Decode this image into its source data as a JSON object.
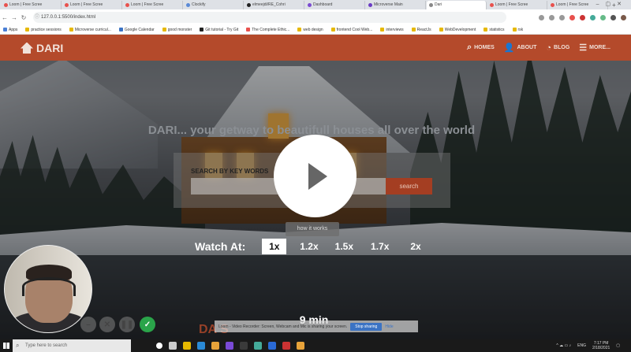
{
  "browser": {
    "tabs": [
      {
        "title": "Loom | Free Scree",
        "icon_color": "#e8514d"
      },
      {
        "title": "Loom | Free Scree",
        "icon_color": "#e8514d"
      },
      {
        "title": "Loom | Free Scree",
        "icon_color": "#e8514d"
      },
      {
        "title": "Clockify",
        "icon_color": "#5b8ad6"
      },
      {
        "title": "elmeejdi/RE_Cohri",
        "icon_color": "#222222"
      },
      {
        "title": "Dashboard",
        "icon_color": "#7b4bd1"
      },
      {
        "title": "Microverse Main",
        "icon_color": "#6b3cc4"
      },
      {
        "title": "Dari",
        "icon_color": "#888888",
        "active": true
      },
      {
        "title": "Loom | Free Scree",
        "icon_color": "#e8514d"
      },
      {
        "title": "Loom | Free Scree",
        "icon_color": "#e8514d"
      }
    ],
    "new_tab": "+",
    "url": "127.0.0.1:5500/index.html",
    "bookmarks": [
      {
        "label": "Apps",
        "color": "#4a7fd6"
      },
      {
        "label": "practice sessions",
        "color": "#e6b800"
      },
      {
        "label": "Microverse curricul...",
        "color": "#e6b800"
      },
      {
        "label": "Google Calendar",
        "color": "#3b73c4"
      },
      {
        "label": "good monster",
        "color": "#e6b800"
      },
      {
        "label": "Git tutorial - Try Git",
        "color": "#222222"
      },
      {
        "label": "The Complete Ethic...",
        "color": "#e8514d"
      },
      {
        "label": "web design",
        "color": "#e6b800"
      },
      {
        "label": "frontend Cool Web...",
        "color": "#e6b800"
      },
      {
        "label": "interviews",
        "color": "#e6b800"
      },
      {
        "label": "ReactJs",
        "color": "#e6b800"
      },
      {
        "label": "WebDevelopment",
        "color": "#e6b800"
      },
      {
        "label": "statistics",
        "color": "#e6b800"
      },
      {
        "label": "rsk",
        "color": "#e6b800"
      }
    ]
  },
  "site": {
    "logo": "DARI",
    "nav": [
      {
        "label": "HOMES",
        "icon": "search-icon",
        "glyph": "⌕"
      },
      {
        "label": "ABOUT",
        "icon": "user-icon",
        "glyph": "👤"
      },
      {
        "label": "BLOG",
        "icon": "rss-icon",
        "glyph": "◔"
      },
      {
        "label": "MORE...",
        "icon": "menu-icon",
        "glyph": "☰"
      }
    ],
    "tagline": "DARI... your getway to beautifull houses all over the world",
    "search_label": "SEARCH BY KEY WORDS",
    "search_button": "search",
    "bottom_title": "DA                              S"
  },
  "player": {
    "tooltip": "how it works",
    "watch_at_label": "Watch At:",
    "speeds": [
      "1x",
      "1.2x",
      "1.5x",
      "1.7x",
      "2x"
    ],
    "selected_speed": "1x",
    "duration": "9 min"
  },
  "share_bar": {
    "text": "Loom - Video Recorder: Screen, Webcam and Mic is sharing your screen.",
    "stop_label": "Stop sharing",
    "hide_label": "Hide"
  },
  "taskbar": {
    "search_placeholder": "Type here to search",
    "time": "7:17 PM",
    "date": "2/18/2021",
    "lang": "ENG"
  }
}
